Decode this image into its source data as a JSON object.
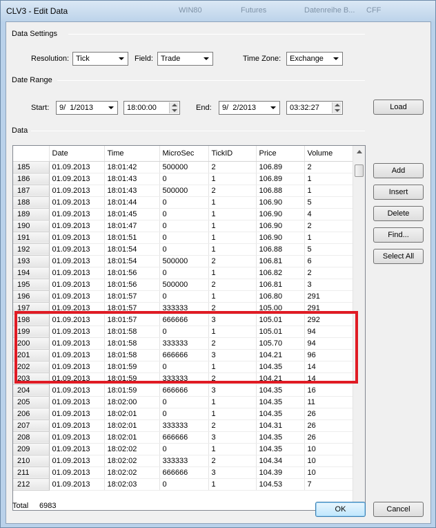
{
  "window": {
    "title": "CLV3 - Edit Data",
    "ghost_titles": [
      "WIN80",
      "Futures",
      "Datenreihe B...",
      "CFF"
    ]
  },
  "data_settings": {
    "group_label": "Data Settings",
    "resolution_label": "Resolution:",
    "resolution_value": "Tick",
    "field_label": "Field:",
    "field_value": "Trade",
    "timezone_label": "Time Zone:",
    "timezone_value": "Exchange"
  },
  "date_range": {
    "group_label": "Date Range",
    "start_label": "Start:",
    "start_date": "9/  1/2013",
    "start_time": "18:00:00",
    "end_label": "End:",
    "end_date": "9/  2/2013",
    "end_time": "03:32:27",
    "load_label": "Load"
  },
  "data": {
    "group_label": "Data",
    "columns": [
      "Date",
      "Time",
      "MicroSec",
      "TickID",
      "Price",
      "Volume"
    ],
    "rows": [
      [
        "185",
        "01.09.2013",
        "18:01:42",
        "500000",
        "2",
        "106.89",
        "2"
      ],
      [
        "186",
        "01.09.2013",
        "18:01:43",
        "0",
        "1",
        "106.89",
        "1"
      ],
      [
        "187",
        "01.09.2013",
        "18:01:43",
        "500000",
        "2",
        "106.88",
        "1"
      ],
      [
        "188",
        "01.09.2013",
        "18:01:44",
        "0",
        "1",
        "106.90",
        "5"
      ],
      [
        "189",
        "01.09.2013",
        "18:01:45",
        "0",
        "1",
        "106.90",
        "4"
      ],
      [
        "190",
        "01.09.2013",
        "18:01:47",
        "0",
        "1",
        "106.90",
        "2"
      ],
      [
        "191",
        "01.09.2013",
        "18:01:51",
        "0",
        "1",
        "106.90",
        "1"
      ],
      [
        "192",
        "01.09.2013",
        "18:01:54",
        "0",
        "1",
        "106.88",
        "5"
      ],
      [
        "193",
        "01.09.2013",
        "18:01:54",
        "500000",
        "2",
        "106.81",
        "6"
      ],
      [
        "194",
        "01.09.2013",
        "18:01:56",
        "0",
        "1",
        "106.82",
        "2"
      ],
      [
        "195",
        "01.09.2013",
        "18:01:56",
        "500000",
        "2",
        "106.81",
        "3"
      ],
      [
        "196",
        "01.09.2013",
        "18:01:57",
        "0",
        "1",
        "106.80",
        "291"
      ],
      [
        "197",
        "01.09.2013",
        "18:01:57",
        "333333",
        "2",
        "105.00",
        "291"
      ],
      [
        "198",
        "01.09.2013",
        "18:01:57",
        "666666",
        "3",
        "105.01",
        "292"
      ],
      [
        "199",
        "01.09.2013",
        "18:01:58",
        "0",
        "1",
        "105.01",
        "94"
      ],
      [
        "200",
        "01.09.2013",
        "18:01:58",
        "333333",
        "2",
        "105.70",
        "94"
      ],
      [
        "201",
        "01.09.2013",
        "18:01:58",
        "666666",
        "3",
        "104.21",
        "96"
      ],
      [
        "202",
        "01.09.2013",
        "18:01:59",
        "0",
        "1",
        "104.35",
        "14"
      ],
      [
        "203",
        "01.09.2013",
        "18:01:59",
        "333333",
        "2",
        "104.21",
        "14"
      ],
      [
        "204",
        "01.09.2013",
        "18:01:59",
        "666666",
        "3",
        "104.35",
        "16"
      ],
      [
        "205",
        "01.09.2013",
        "18:02:00",
        "0",
        "1",
        "104.35",
        "11"
      ],
      [
        "206",
        "01.09.2013",
        "18:02:01",
        "0",
        "1",
        "104.35",
        "26"
      ],
      [
        "207",
        "01.09.2013",
        "18:02:01",
        "333333",
        "2",
        "104.31",
        "26"
      ],
      [
        "208",
        "01.09.2013",
        "18:02:01",
        "666666",
        "3",
        "104.35",
        "26"
      ],
      [
        "209",
        "01.09.2013",
        "18:02:02",
        "0",
        "1",
        "104.35",
        "10"
      ],
      [
        "210",
        "01.09.2013",
        "18:02:02",
        "333333",
        "2",
        "104.34",
        "10"
      ],
      [
        "211",
        "01.09.2013",
        "18:02:02",
        "666666",
        "3",
        "104.39",
        "10"
      ],
      [
        "212",
        "01.09.2013",
        "18:02:03",
        "0",
        "1",
        "104.53",
        "7"
      ]
    ],
    "highlight_color": "#e01b24"
  },
  "side_buttons": {
    "add": "Add",
    "insert": "Insert",
    "delete": "Delete",
    "find": "Find...",
    "select_all": "Select All"
  },
  "footer": {
    "total_label": "Total",
    "total_value": "6983",
    "ok": "OK",
    "cancel": "Cancel"
  }
}
